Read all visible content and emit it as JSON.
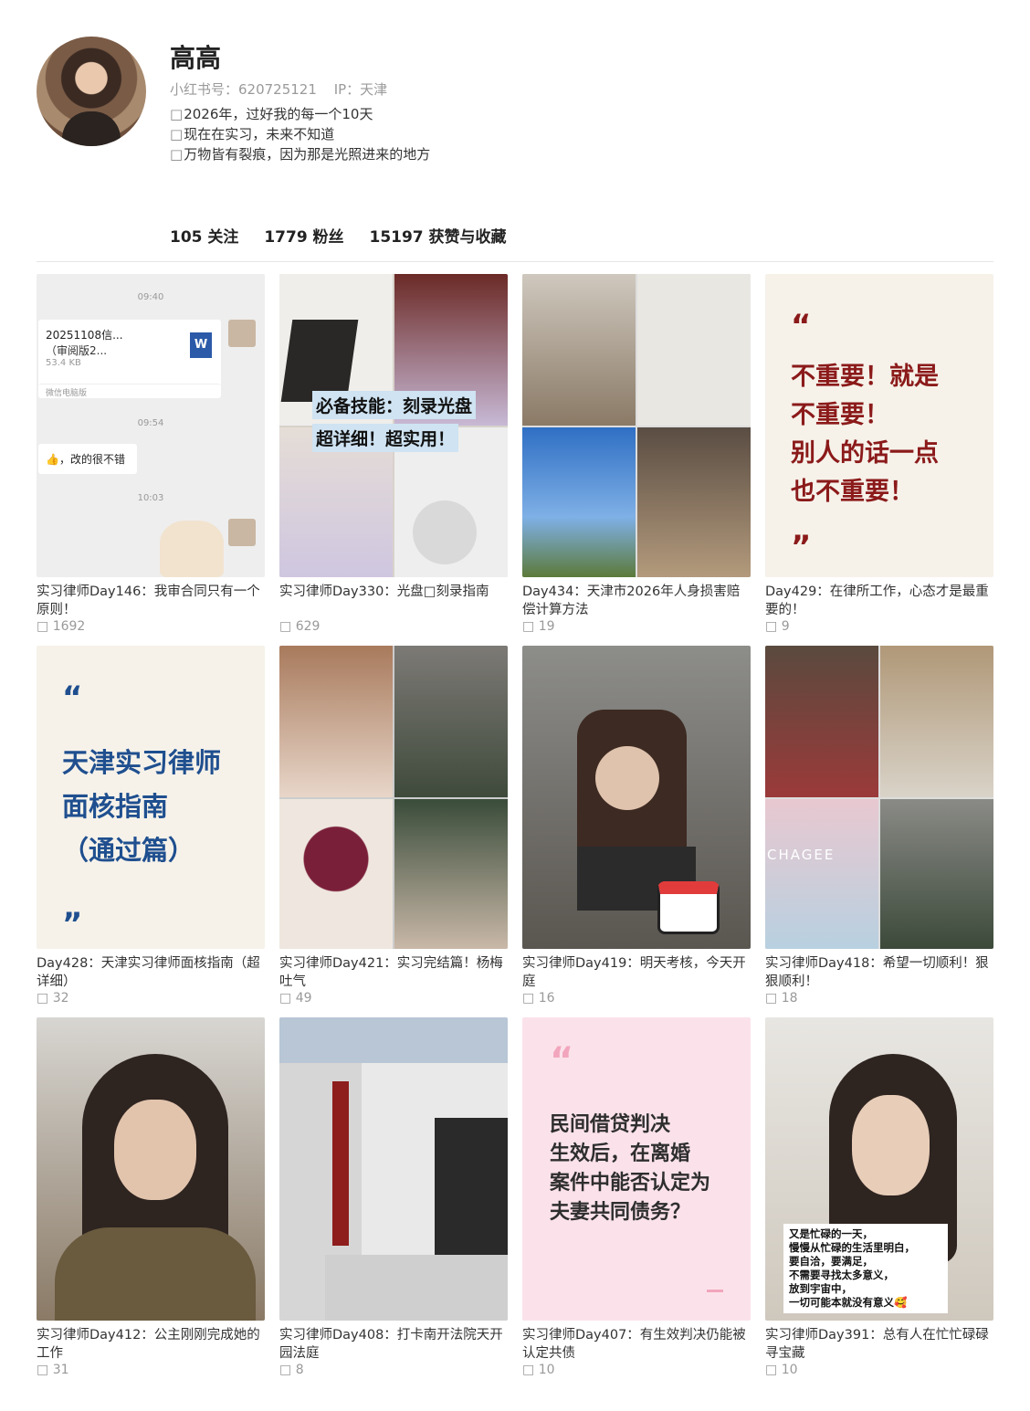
{
  "profile": {
    "name": "高高",
    "xhs_id": "小红书号：620725121",
    "ip": "IP：天津",
    "bio": [
      "2026年，过好我的每一个10天",
      "现在在实习，未来不知道",
      "万物皆有裂痕，因为那是光照进来的地方"
    ]
  },
  "stats": {
    "following": "105 关注",
    "followers": "1779 粉丝",
    "likes": "15197 获赞与收藏"
  },
  "posts": [
    {
      "title": "实习律师Day146：我审合同只有一个原则！",
      "likes": "1692"
    },
    {
      "title": "实习律师Day330：光盘□刻录指南",
      "likes": "629"
    },
    {
      "title": "Day434：天津市2026年人身损害赔偿计算方法",
      "likes": "19"
    },
    {
      "title": "Day429：在律所工作，心态才是最重要的！",
      "likes": "9"
    },
    {
      "title": "Day428：天津实习律师面核指南（超详细）",
      "likes": "32"
    },
    {
      "title": "实习律师Day421：实习完结篇！杨梅吐气",
      "likes": "49"
    },
    {
      "title": "实习律师Day419：明天考核，今天开庭",
      "likes": "16"
    },
    {
      "title": "实习律师Day418：希望一切顺利！狠狠顺利！",
      "likes": "18"
    },
    {
      "title": "实习律师Day412：公主刚刚完成她的工作",
      "likes": "31"
    },
    {
      "title": "实习律师Day408：打卡南开法院天开园法庭",
      "likes": "8"
    },
    {
      "title": "实习律师Day407：有生效判决仍能被认定共债",
      "likes": "10"
    },
    {
      "title": "实习律师Day391：总有人在忙忙碌碌寻宝藏",
      "likes": "10"
    }
  ],
  "thumbs": {
    "t1": {
      "time1": "09:40",
      "file_name": "20251108信...",
      "file_sub": "（审阅版2...",
      "file_size": "53.4 KB",
      "source": "微信电脑版",
      "time2": "09:54",
      "reply": "，改的很不错",
      "time3": "10:03"
    },
    "t2": {
      "line1": "必备技能：刻录光盘",
      "line2": "超详细！超实用！"
    },
    "t4": {
      "text": [
        "不重要！就是",
        "不重要！",
        "别人的话一点",
        "也不重要！"
      ]
    },
    "t5": {
      "text": [
        "天津实习律师",
        "面核指南",
        "（通过篇）"
      ]
    },
    "t8": {
      "brand": "CHAGEE"
    },
    "t11": {
      "text": [
        "民间借贷判决",
        "生效后，在离婚",
        "案件中能否认定为",
        "夫妻共同债务？"
      ]
    },
    "t12": {
      "text": [
        "又是忙碌的一天，",
        "慢慢从忙碌的生活里明白，",
        "要自洽，要满足，",
        "不需要寻找太多意义，",
        "放到宇宙中，",
        "一切可能本就没有意义🥰"
      ]
    }
  },
  "colors": {
    "quote_red": "#8b1a1a",
    "quote_blue": "#1f4f8f",
    "pink_bg": "#fbe2ea",
    "cream_bg": "#f6f2ea"
  }
}
